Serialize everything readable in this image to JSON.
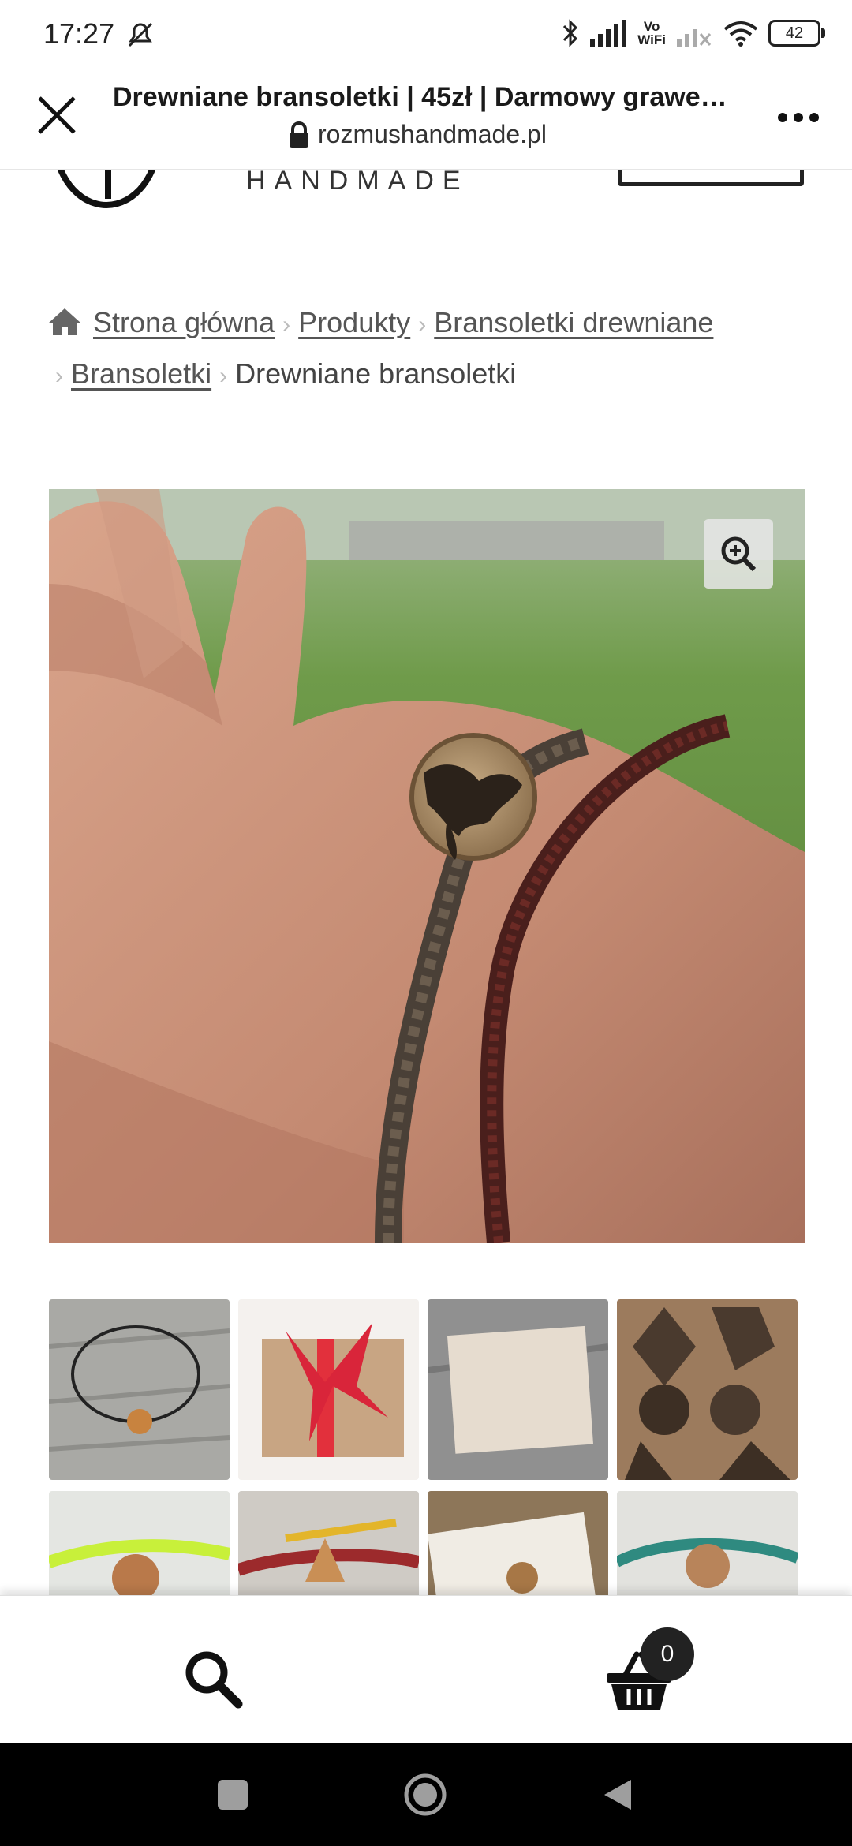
{
  "status_bar": {
    "time": "17:27",
    "battery": "42",
    "vowifi_line1": "Vo",
    "vowifi_line2": "WiFi"
  },
  "browser": {
    "title": "Drewniane bransoletki | 45zł | Darmowy grawer…",
    "url": "rozmushandmade.pl"
  },
  "site_header": {
    "brand_sub": "HANDMADE"
  },
  "breadcrumb": {
    "items": [
      "Strona główna",
      "Produkty",
      "Bransoletki drewniane",
      "Bransoletki"
    ],
    "current": "Drewniane bransoletki"
  },
  "bottom_nav": {
    "cart_count": "0"
  },
  "colors": {
    "accent": "#222222",
    "link": "#555555",
    "system_nav_bg": "#000000"
  },
  "icons": [
    "close-icon",
    "lock-icon",
    "more-icon",
    "home-icon",
    "zoom-in-icon",
    "search-icon",
    "cart-icon",
    "recent-apps-icon",
    "home-button-icon",
    "back-icon"
  ]
}
